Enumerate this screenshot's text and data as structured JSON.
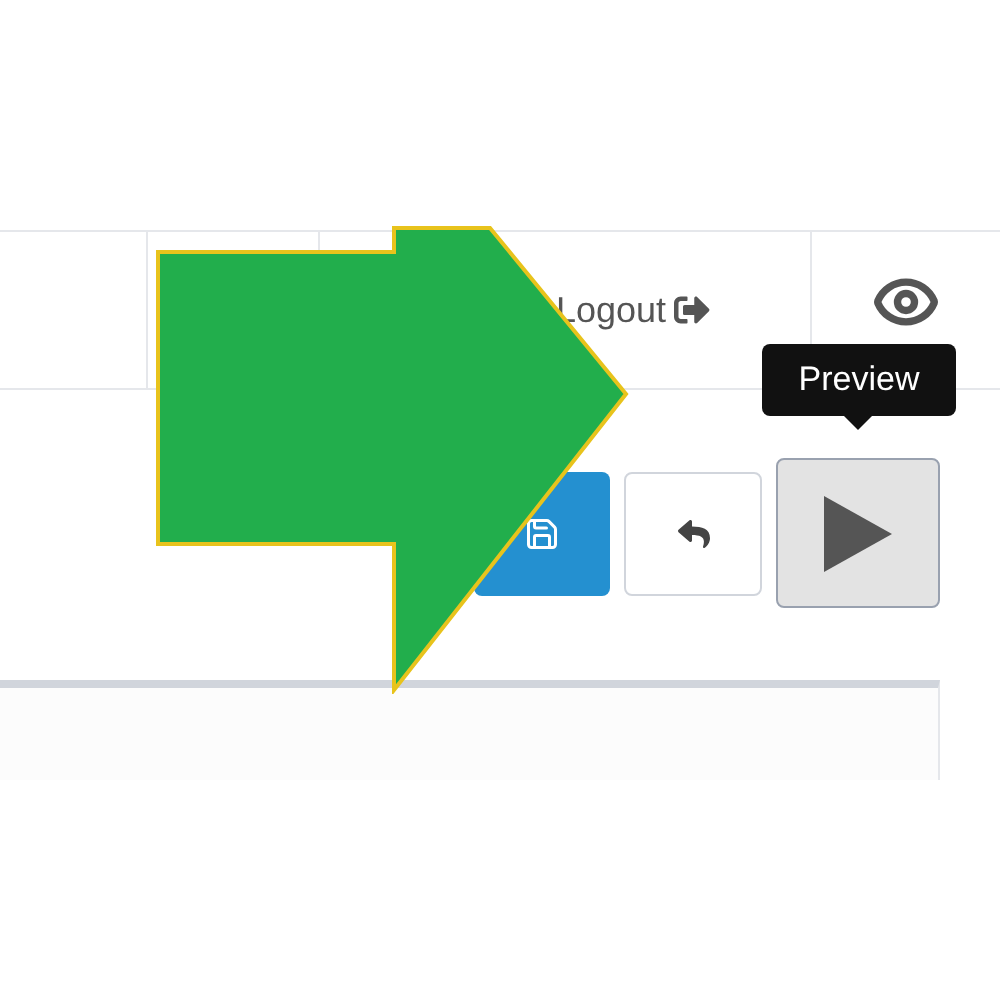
{
  "nav": {
    "logout_label": "Logout"
  },
  "toolbar": {
    "buttons": [
      {
        "kind": "save"
      },
      {
        "kind": "undo"
      },
      {
        "kind": "preview",
        "tooltip": "Preview"
      }
    ]
  }
}
